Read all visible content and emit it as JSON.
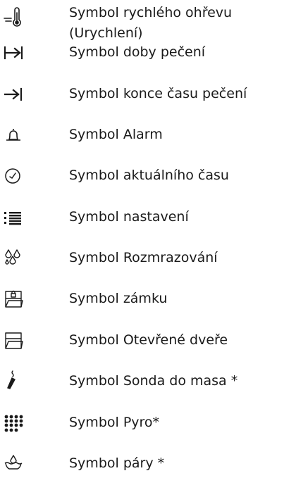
{
  "legend": {
    "rows": [
      {
        "icon": "rapid-heat-thermometer-icon",
        "label_line1": "Symbol rychlého ohřevu",
        "label_line2": "(Urychlení)"
      },
      {
        "icon": "cooking-duration-icon",
        "label": "Symbol doby pečení"
      },
      {
        "icon": "cooking-end-time-icon",
        "label": "Symbol konce času pečení"
      },
      {
        "icon": "alarm-bell-icon",
        "label": "Symbol Alarm"
      },
      {
        "icon": "clock-icon",
        "label": "Symbol aktuálního času"
      },
      {
        "icon": "settings-list-icon",
        "label": "Symbol nastavení"
      },
      {
        "icon": "defrost-drops-icon",
        "label": "Symbol Rozmrazování"
      },
      {
        "icon": "lock-folder-icon",
        "label": "Symbol zámku"
      },
      {
        "icon": "open-door-icon",
        "label": "Symbol Otevřené dveře"
      },
      {
        "icon": "meat-probe-icon",
        "label": "Symbol Sonda do masa *"
      },
      {
        "icon": "pyrolysis-dots-icon",
        "label": "Symbol Pyro*"
      },
      {
        "icon": "steam-icon",
        "label": "Symbol páry *"
      }
    ]
  }
}
